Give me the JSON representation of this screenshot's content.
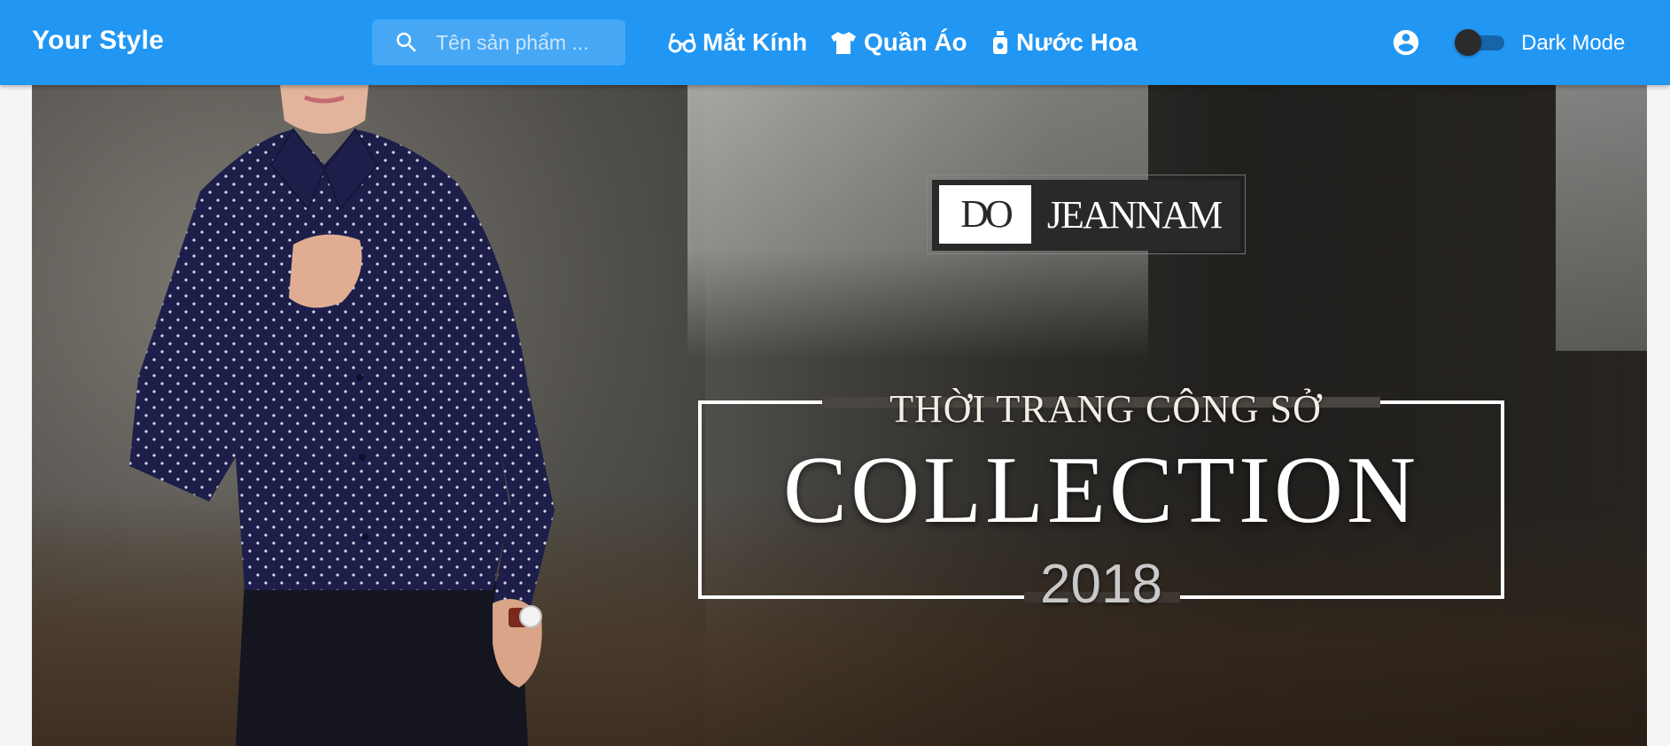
{
  "app": {
    "brand": "Your Style",
    "colors": {
      "appbar": "#2196f3",
      "text": "#ffffff"
    }
  },
  "search": {
    "placeholder": "Tên sản phẩm ...",
    "value": "",
    "icon": "search-icon"
  },
  "nav": [
    {
      "label": "Mắt Kính",
      "icon": "glasses-icon"
    },
    {
      "label": "Quần Áo",
      "icon": "tshirt-icon"
    },
    {
      "label": "Nước Hoa",
      "icon": "perfume-icon"
    }
  ],
  "account": {
    "icon": "account-circle-icon"
  },
  "dark_mode": {
    "label": "Dark Mode",
    "enabled": false
  },
  "banner": {
    "logo_text": "DO JEANNAM",
    "subtitle": "THỜI TRANG  CÔNG SỞ",
    "headline": "COLLECTION",
    "year": "2018"
  }
}
